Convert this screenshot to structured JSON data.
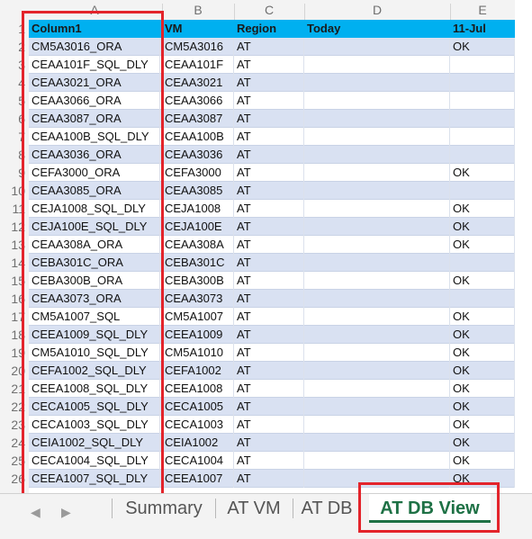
{
  "columns": {
    "letters": [
      "A",
      "B",
      "C",
      "D",
      "E"
    ]
  },
  "table": {
    "headers": [
      "Column1",
      "VM",
      "Region",
      "Today",
      "11-Jul"
    ],
    "rows": [
      [
        "CM5A3016_ORA",
        "CM5A3016",
        "AT",
        "",
        "OK"
      ],
      [
        "CEAA101F_SQL_DLY",
        "CEAA101F",
        "AT",
        "",
        ""
      ],
      [
        "CEAA3021_ORA",
        "CEAA3021",
        "AT",
        "",
        ""
      ],
      [
        "CEAA3066_ORA",
        "CEAA3066",
        "AT",
        "",
        ""
      ],
      [
        "CEAA3087_ORA",
        "CEAA3087",
        "AT",
        "",
        ""
      ],
      [
        "CEAA100B_SQL_DLY",
        "CEAA100B",
        "AT",
        "",
        ""
      ],
      [
        "CEAA3036_ORA",
        "CEAA3036",
        "AT",
        "",
        ""
      ],
      [
        "CEFA3000_ORA",
        "CEFA3000",
        "AT",
        "",
        "OK"
      ],
      [
        "CEAA3085_ORA",
        "CEAA3085",
        "AT",
        "",
        ""
      ],
      [
        "CEJA1008_SQL_DLY",
        "CEJA1008",
        "AT",
        "",
        "OK"
      ],
      [
        "CEJA100E_SQL_DLY",
        "CEJA100E",
        "AT",
        "",
        "OK"
      ],
      [
        "CEAA308A_ORA",
        "CEAA308A",
        "AT",
        "",
        "OK"
      ],
      [
        "CEBA301C_ORA",
        "CEBA301C",
        "AT",
        "",
        ""
      ],
      [
        "CEBA300B_ORA",
        "CEBA300B",
        "AT",
        "",
        "OK"
      ],
      [
        "CEAA3073_ORA",
        "CEAA3073",
        "AT",
        "",
        ""
      ],
      [
        "CM5A1007_SQL",
        "CM5A1007",
        "AT",
        "",
        "OK"
      ],
      [
        "CEEA1009_SQL_DLY",
        "CEEA1009",
        "AT",
        "",
        "OK"
      ],
      [
        "CM5A1010_SQL_DLY",
        "CM5A1010",
        "AT",
        "",
        "OK"
      ],
      [
        "CEFA1002_SQL_DLY",
        "CEFA1002",
        "AT",
        "",
        "OK"
      ],
      [
        "CEEA1008_SQL_DLY",
        "CEEA1008",
        "AT",
        "",
        "OK"
      ],
      [
        "CECA1005_SQL_DLY",
        "CECA1005",
        "AT",
        "",
        "OK"
      ],
      [
        "CECA1003_SQL_DLY",
        "CECA1003",
        "AT",
        "",
        "OK"
      ],
      [
        "CEIA1002_SQL_DLY",
        "CEIA1002",
        "AT",
        "",
        "OK"
      ],
      [
        "CECA1004_SQL_DLY",
        "CECA1004",
        "AT",
        "",
        "OK"
      ],
      [
        "CEEA1007_SQL_DLY",
        "CEEA1007",
        "AT",
        "",
        "OK"
      ]
    ]
  },
  "row_numbers": [
    "1",
    "2",
    "3",
    "4",
    "5",
    "6",
    "7",
    "8",
    "9",
    "10",
    "11",
    "12",
    "13",
    "14",
    "15",
    "16",
    "17",
    "18",
    "19",
    "20",
    "21",
    "22",
    "23",
    "24",
    "25",
    "26"
  ],
  "tabs": [
    {
      "label": "Summary",
      "active": false
    },
    {
      "label": "AT VM",
      "active": false
    },
    {
      "label": "AT DB",
      "active": false
    },
    {
      "label": "AT DB View",
      "active": true
    }
  ],
  "nav": {
    "prev": "◀",
    "next": "▶"
  },
  "colors": {
    "header_fill": "#00b0f0",
    "band_fill": "#d9e1f2",
    "highlight": "#e3242b",
    "active_tab": "#1e7145"
  }
}
